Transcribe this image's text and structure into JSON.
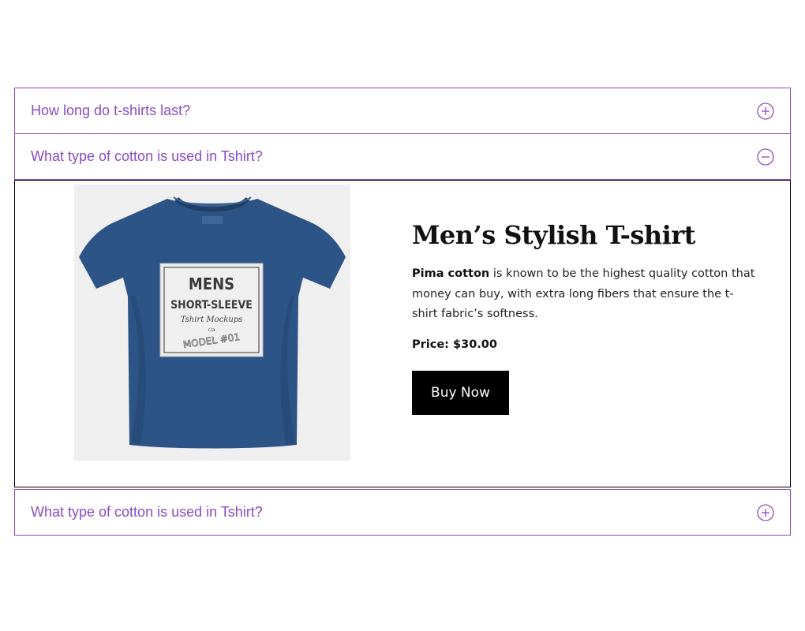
{
  "accordion": {
    "items": [
      {
        "question": "How long do t-shirts last?",
        "state": "collapsed",
        "icon": "plus-circle-icon"
      },
      {
        "question": "What type of cotton is used in Tshirt?",
        "state": "expanded",
        "icon": "minus-circle-icon"
      },
      {
        "question": "What type of cotton is used in Tshirt?",
        "state": "collapsed",
        "icon": "plus-circle-icon"
      }
    ]
  },
  "product": {
    "title": "Men’s Stylish T-shirt",
    "desc_bold": "Pima cotton",
    "desc_rest": " is known to be the highest quality cotton that money can buy, with extra long fibers that ensure the t-shirt fabric’s softness.",
    "price": "Price: $30.00",
    "buy_label": "Buy Now",
    "image": {
      "line1": "MENS",
      "line2": "SHORT-SLEEVE",
      "line3": "Tshirt Mockups",
      "line4": "c/a",
      "line5": "MODEL #01",
      "shirt_color": "#2d5486",
      "bg_color": "#efefef"
    }
  },
  "colors": {
    "accent": "#8a4cc4",
    "button_bg": "#000000",
    "button_text": "#ffffff"
  }
}
